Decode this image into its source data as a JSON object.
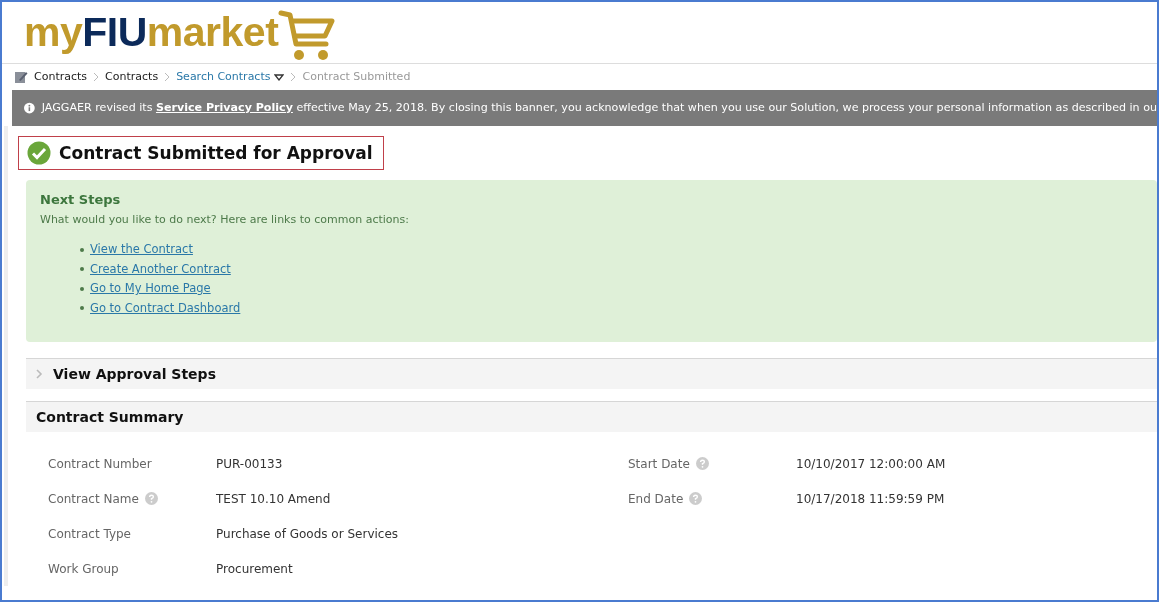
{
  "logo": {
    "prefix": "my",
    "brand": "FIU",
    "suffix": "market"
  },
  "breadcrumb": [
    {
      "label": "Contracts",
      "kind": "text",
      "dropdown": false
    },
    {
      "label": "Contracts",
      "kind": "text",
      "dropdown": false
    },
    {
      "label": "Search Contracts",
      "kind": "link",
      "dropdown": true
    },
    {
      "label": "Contract Submitted",
      "kind": "current",
      "dropdown": false
    }
  ],
  "banner": {
    "before": "JAGGAER revised its",
    "link": "Service Privacy Policy",
    "after": "effective May 25, 2018. By closing this banner, you acknowledge that when you use our Solution, we process your personal information as described in ou"
  },
  "page_title": "Contract Submitted for Approval",
  "next_steps": {
    "title": "Next Steps",
    "intro": "What would you like to do next? Here are links to common actions:",
    "links": [
      "View the Contract",
      "Create Another Contract",
      "Go to My Home Page",
      "Go to Contract Dashboard"
    ]
  },
  "approval_section": {
    "title": "View Approval Steps",
    "expanded": false
  },
  "summary": {
    "title": "Contract Summary",
    "left": [
      {
        "label": "Contract Number",
        "help": false,
        "value": "PUR-00133"
      },
      {
        "label": "Contract Name",
        "help": true,
        "value": "TEST 10.10 Amend"
      },
      {
        "label": "Contract Type",
        "help": false,
        "value": "Purchase of Goods or Services"
      },
      {
        "label": "Work Group",
        "help": false,
        "value": "Procurement"
      }
    ],
    "right": [
      {
        "label": "Start Date",
        "help": true,
        "value": "10/10/2017 12:00:00 AM"
      },
      {
        "label": "End Date",
        "help": true,
        "value": "10/17/2018 11:59:59 PM"
      }
    ]
  }
}
